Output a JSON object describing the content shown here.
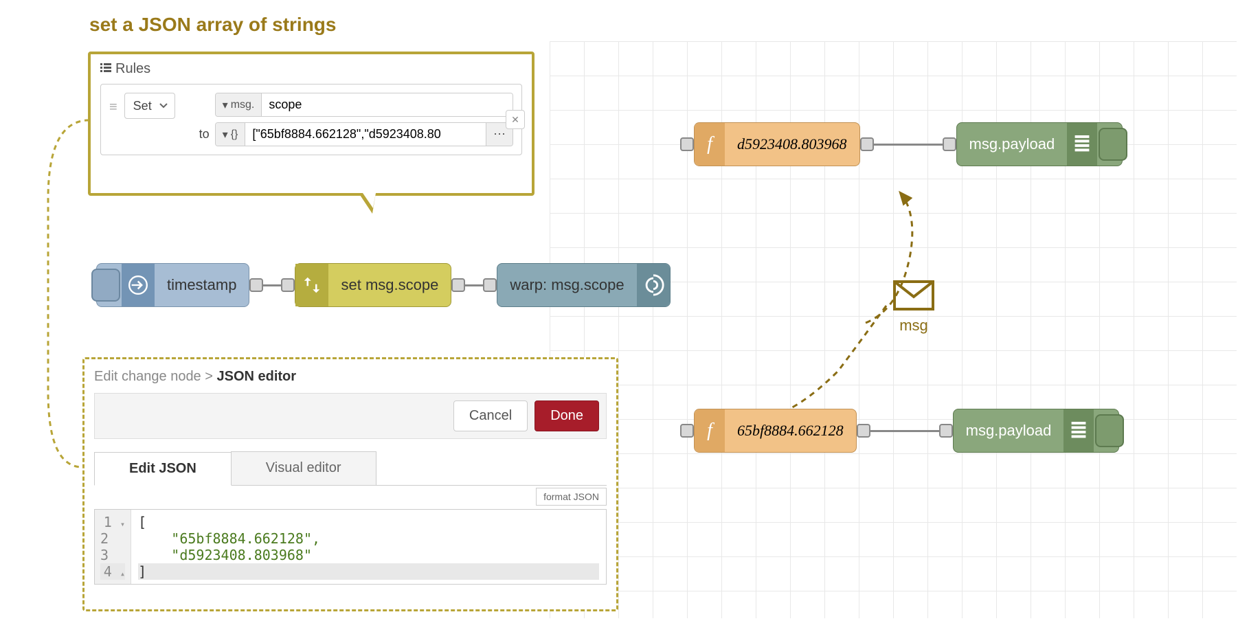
{
  "title": "set a JSON array of strings",
  "rules_panel": {
    "header": "Rules",
    "action": "Set",
    "msg_prefix": "msg.",
    "property": "scope",
    "to_label": "to",
    "json_prefix": "{}",
    "json_value": "[\"65bf8884.662128\",\"d5923408.80"
  },
  "nodes": {
    "inject": "timestamp",
    "change": "set msg.scope",
    "warp": "warp: msg.scope",
    "fn1": "d5923408.803968",
    "fn2": "65bf8884.662128",
    "debug": "msg.payload"
  },
  "msg_label": "msg",
  "json_editor": {
    "breadcrumb_prefix": "Edit change node > ",
    "breadcrumb_current": "JSON editor",
    "cancel": "Cancel",
    "done": "Done",
    "tab_edit": "Edit JSON",
    "tab_visual": "Visual editor",
    "format_btn": "format JSON",
    "code_lines": {
      "l1": "[",
      "l2": "\"65bf8884.662128\",",
      "l3": "\"d5923408.803968\"",
      "l4": "]"
    }
  }
}
